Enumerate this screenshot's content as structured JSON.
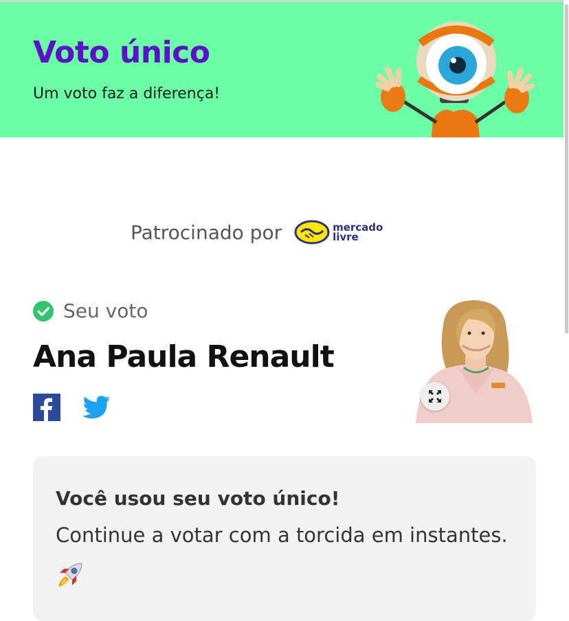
{
  "header": {
    "title": "Voto único",
    "subtitle": "Um voto faz a diferença!",
    "background": "#6cfca6",
    "title_color": "#5a13c4"
  },
  "sponsor": {
    "label": "Patrocinado por",
    "brand_line1": "mercado",
    "brand_line2": "livre"
  },
  "vote": {
    "status_label": "Seu voto",
    "candidate": "Ana Paula Renault",
    "share_icons": [
      "facebook-icon",
      "twitter-icon"
    ],
    "expand_icon": "expand-icon"
  },
  "notice": {
    "title": "Você usou seu voto único!",
    "text": "Continue a votar com a torcida em instantes.",
    "emoji_icon": "rocket-icon"
  }
}
